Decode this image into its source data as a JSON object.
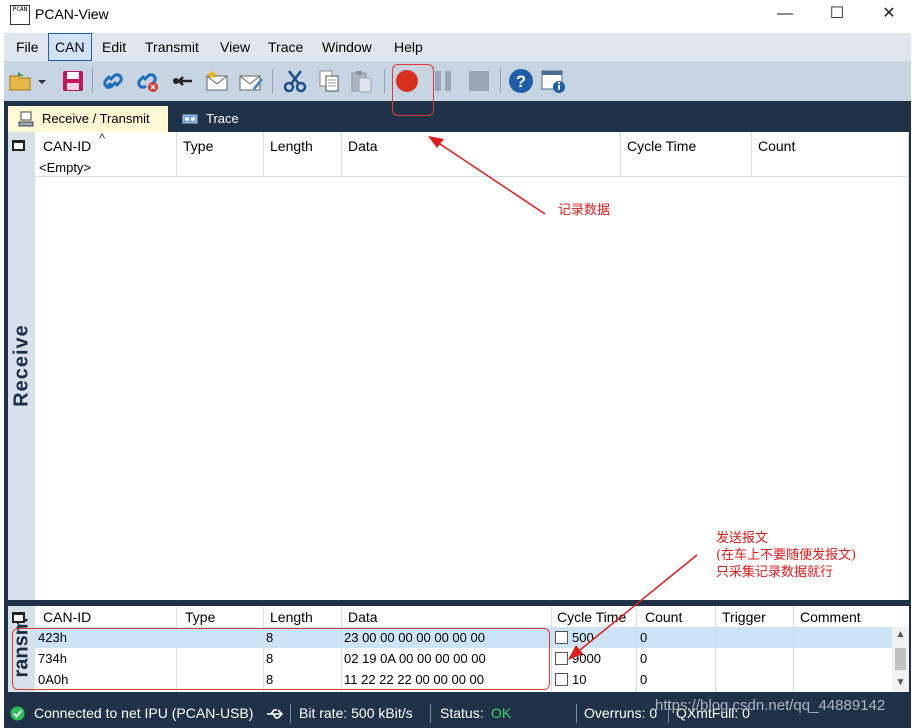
{
  "window": {
    "title": "PCAN-View",
    "app_icon_text": "PCAN",
    "controls": {
      "minimize": "—",
      "maximize": "☐",
      "close": "✕"
    }
  },
  "menu": {
    "items": [
      {
        "label": "File"
      },
      {
        "label": "CAN",
        "active": true
      },
      {
        "label": "Edit"
      },
      {
        "label": "Transmit"
      },
      {
        "label": "View"
      },
      {
        "label": "Trace"
      },
      {
        "label": "Window"
      },
      {
        "label": "Help"
      }
    ]
  },
  "toolbar": {
    "icons": [
      "open-folder-icon",
      "save-icon",
      "connect-icon",
      "disconnect-icon",
      "back-arrow-icon",
      "new-message-icon",
      "edit-message-icon",
      "cut-icon",
      "copy-icon",
      "paste-icon",
      "record-icon",
      "pause-icon",
      "stop-icon",
      "help-icon",
      "info-window-icon"
    ]
  },
  "tabs": [
    {
      "label": "Receive / Transmit",
      "active": true
    },
    {
      "label": "Trace",
      "active": false
    }
  ],
  "receive": {
    "side_label": "Receive",
    "columns": [
      "CAN-ID",
      "Type",
      "Length",
      "Data",
      "Cycle Time",
      "Count"
    ],
    "empty_text": "<Empty>",
    "sort_indicator": "^"
  },
  "transmit": {
    "side_label": "ransm",
    "columns": [
      "CAN-ID",
      "Type",
      "Length",
      "Data",
      "Cycle Time",
      "Count",
      "Trigger",
      "Comment"
    ],
    "rows": [
      {
        "can_id": "423h",
        "type": "",
        "length": "8",
        "data": "23 00 00 00 00 00 00 00",
        "cycle_time": "500",
        "count": "0",
        "trigger": "",
        "comment": ""
      },
      {
        "can_id": "734h",
        "type": "",
        "length": "8",
        "data": "02 19 0A 00 00 00 00 00",
        "cycle_time": "9000",
        "count": "0",
        "trigger": "",
        "comment": ""
      },
      {
        "can_id": "0A0h",
        "type": "",
        "length": "8",
        "data": "11 22 22 22 00 00 00 00",
        "cycle_time": "10",
        "count": "0",
        "trigger": "",
        "comment": ""
      }
    ]
  },
  "status": {
    "connection": "Connected to net IPU (PCAN-USB)",
    "bitrate": "Bit rate: 500 kBit/s",
    "status_label": "Status:",
    "status_value": "OK",
    "overruns": "Overruns: 0",
    "qxmtfull": "QXmtFull: 0"
  },
  "annotations": {
    "record_note": "记录数据",
    "send_note": "发送报文\n(在车上不要随便发报文)\n只采集记录数据就行"
  },
  "watermark": "https://blog.csdn.net/qq_44889142",
  "colors": {
    "frame": "#1f3247",
    "menubar": "#dfe6ee",
    "toolbar": "#c7d4e2",
    "active_tab": "#fff8d4",
    "selection": "#cde4f7",
    "annotation": "#e01b1b",
    "record": "#d9301f",
    "status_ok": "#3fd06a"
  }
}
